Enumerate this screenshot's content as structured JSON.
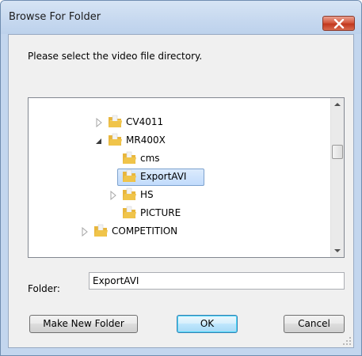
{
  "window": {
    "title": "Browse For Folder",
    "colors": {
      "frame": "#c3d6ee",
      "client": "#f0f0f0",
      "close_red": "#c2381e",
      "folder_yellow": "#f0c44a",
      "selection": "#c1dbfc"
    }
  },
  "prompt": "Please select the video file directory.",
  "tree": {
    "items": [
      {
        "label": "CV4011",
        "expander": "collapsed",
        "icon": "folder-icon"
      },
      {
        "label": "MR400X",
        "expander": "expanded",
        "icon": "folder-icon"
      },
      {
        "label": "cms",
        "expander": "none",
        "icon": "folder-icon"
      },
      {
        "label": "ExportAVI",
        "expander": "none",
        "icon": "folder-icon",
        "selected": true
      },
      {
        "label": "HS",
        "expander": "collapsed",
        "icon": "folder-icon"
      },
      {
        "label": "PICTURE",
        "expander": "none",
        "icon": "folder-icon"
      },
      {
        "label": "COMPETITION",
        "expander": "collapsed",
        "icon": "folder-icon"
      }
    ]
  },
  "folder": {
    "label": "Folder:",
    "value": "ExportAVI"
  },
  "buttons": {
    "make_new_folder": "Make New Folder",
    "ok": "OK",
    "cancel": "Cancel"
  }
}
